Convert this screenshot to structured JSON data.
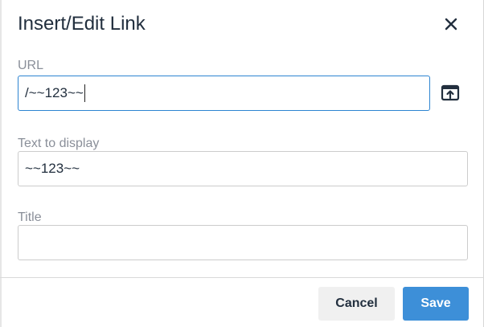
{
  "dialog": {
    "title": "Insert/Edit Link",
    "close_icon": "close-icon"
  },
  "url": {
    "label": "URL",
    "value": "/~~123~~",
    "browse_icon": "browse-link-icon"
  },
  "text_to_display": {
    "label": "Text to display",
    "value": "~~123~~"
  },
  "title_field": {
    "label": "Title",
    "value": ""
  },
  "footer": {
    "cancel_label": "Cancel",
    "save_label": "Save"
  },
  "colors": {
    "accent": "#3d8fd8",
    "focus_border": "#2d84d1",
    "text": "#222f3e",
    "label": "#8a8f99"
  }
}
